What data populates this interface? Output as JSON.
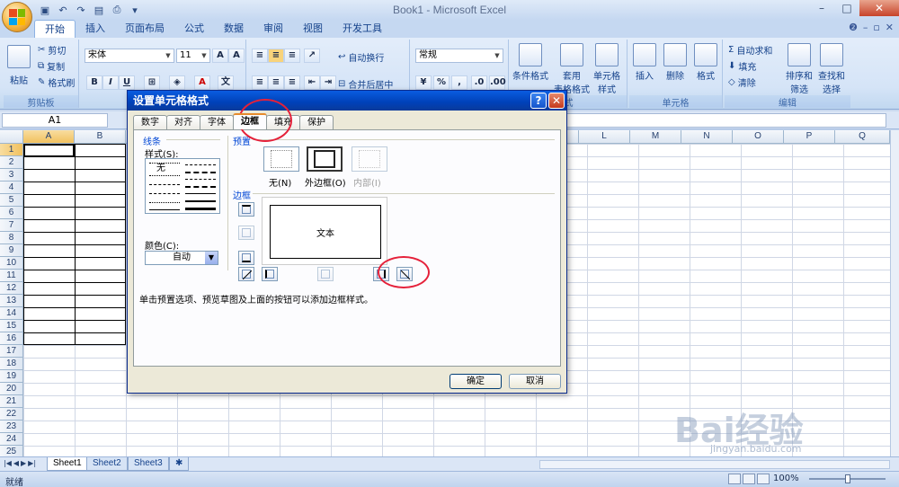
{
  "window": {
    "title": "Book1 - Microsoft Excel"
  },
  "ribbon_tabs": [
    "开始",
    "插入",
    "页面布局",
    "公式",
    "数据",
    "审阅",
    "视图",
    "开发工具"
  ],
  "clipboard": {
    "paste": "粘贴",
    "cut": "剪切",
    "copy": "复制",
    "format_painter": "格式刷",
    "label": "剪贴板"
  },
  "font": {
    "name": "宋体",
    "size": "11"
  },
  "alignment": {
    "wrap": "自动换行",
    "merge": "合并后居中"
  },
  "number": {
    "format": "常规"
  },
  "styles": {
    "conditional": "条件格式",
    "table": "套用",
    "table2": "表格格式",
    "cell": "单元格",
    "cell2": "样式",
    "label": "式"
  },
  "cells": {
    "insert": "插入",
    "delete": "删除",
    "format": "格式",
    "label": "单元格"
  },
  "editing": {
    "autosum": "自动求和",
    "fill": "填充",
    "clear": "清除",
    "sort": "排序和",
    "sort2": "筛选",
    "find": "查找和",
    "find2": "选择",
    "label": "编辑"
  },
  "formula_bar": {
    "namebox": "A1"
  },
  "columns": [
    "A",
    "B",
    "L",
    "M",
    "N",
    "O",
    "P",
    "Q"
  ],
  "rows": [
    "1",
    "2",
    "3",
    "4",
    "5",
    "6",
    "7",
    "8",
    "9",
    "10",
    "11",
    "12",
    "13",
    "14",
    "15",
    "16",
    "17",
    "18",
    "19",
    "20",
    "21",
    "22",
    "23",
    "24",
    "25"
  ],
  "sheets": [
    "Sheet1",
    "Sheet2",
    "Sheet3"
  ],
  "status": {
    "text": "就绪",
    "zoom": "100%"
  },
  "dialog": {
    "title": "设置单元格格式",
    "tabs": [
      "数字",
      "对齐",
      "字体",
      "边框",
      "填充",
      "保护"
    ],
    "line_section": "线条",
    "style_label": "样式(S):",
    "none_style": "无",
    "color_label": "颜色(C):",
    "color_value": "自动",
    "preset_section": "预置",
    "preset_none": "无(N)",
    "preset_outline": "外边框(O)",
    "preset_inside": "内部(I)",
    "border_section": "边框",
    "preview_text": "文本",
    "hint": "单击预置选项、预览草图及上面的按钮可以添加边框样式。",
    "ok": "确定",
    "cancel": "取消"
  },
  "watermark": {
    "brand": "Bai经验",
    "url": "jingyan.baidu.com"
  },
  "colors": {
    "accent": "#15428b",
    "highlight": "#e5213a",
    "dialog_title": "#0041b8"
  }
}
